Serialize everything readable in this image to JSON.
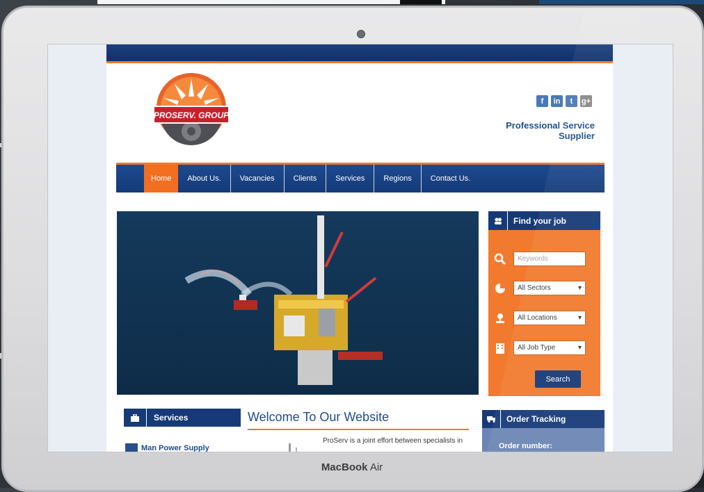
{
  "brand": {
    "mac_bold": "MacBook",
    "mac_light": "Air"
  },
  "site": {
    "logo_text": "PROSERV. GROUP",
    "social": [
      "f",
      "in",
      "t",
      "g+"
    ],
    "tagline": "Professional Service Supplier",
    "nav": [
      "Home",
      "About Us.",
      "Vacancies",
      "Clients",
      "Services",
      "Regions",
      "Contact Us."
    ],
    "finder": {
      "title": "Find your job",
      "keywords_placeholder": "Keywords",
      "sectors": "All Sectors",
      "locations": "All Locations",
      "job_type": "All Job Type",
      "search": "Search"
    },
    "services": {
      "title": "Services",
      "item1": "Man Power Supply"
    },
    "welcome": {
      "title": "Welcome To Our Website",
      "intro": "ProServ is a joint effort between specialists in"
    },
    "order": {
      "title": "Order Tracking",
      "label": "Order number:"
    }
  },
  "colors": {
    "navy": "#163a77",
    "orange": "#f27a2e",
    "accent_blue": "#1d4a8f"
  }
}
